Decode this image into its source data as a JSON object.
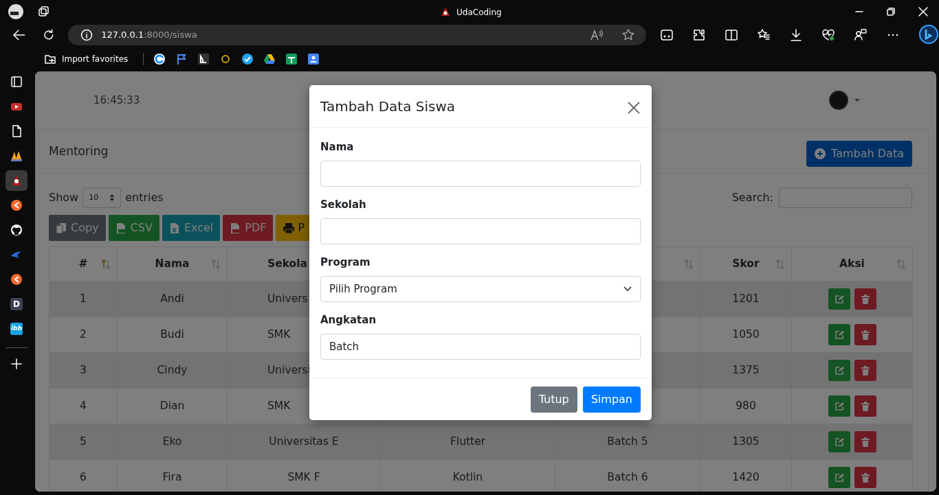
{
  "browser": {
    "title": "UdaCoding",
    "address_host": "127.0.0.1",
    "address_path": ":8000/siswa",
    "favorites_label": "Import favorites"
  },
  "sidebar": [
    {
      "kind": "tabs",
      "selected": false
    },
    {
      "kind": "video",
      "selected": false
    },
    {
      "kind": "document",
      "selected": false
    },
    {
      "kind": "sails",
      "selected": false
    },
    {
      "kind": "rocket",
      "selected": true
    },
    {
      "kind": "orange",
      "selected": false
    },
    {
      "kind": "github",
      "selected": false
    },
    {
      "kind": "bird",
      "selected": false
    },
    {
      "kind": "orange",
      "selected": false
    },
    {
      "kind": "letter",
      "text": "D",
      "selected": false
    },
    {
      "kind": "letter",
      "text": "ibb",
      "selected": false
    },
    {
      "kind": "add",
      "selected": false
    }
  ],
  "page": {
    "clock": "16:45:33",
    "card_title": "Mentoring",
    "add_button": "Tambah Data",
    "show_label": "Show",
    "entries_value": "10",
    "entries_label": "entries",
    "search_label": "Search:",
    "export_buttons": [
      {
        "kind": "copy",
        "label": "Copy"
      },
      {
        "kind": "csv",
        "label": "CSV"
      },
      {
        "kind": "excel",
        "label": "Excel"
      },
      {
        "kind": "pdf",
        "label": "PDF"
      },
      {
        "kind": "print",
        "label": "P"
      }
    ]
  },
  "table": {
    "columns": [
      {
        "label": "#",
        "sorted": true
      },
      {
        "label": "Nama",
        "sorted": false
      },
      {
        "label": "Sekola"
      },
      {},
      {
        "sorted": false
      },
      {
        "label": "Skor",
        "sorted": false
      },
      {
        "label": "Aksi",
        "sorted": false
      }
    ],
    "rows": [
      {
        "number": "1",
        "nama": "Andi",
        "sekolah": "Univers",
        "skor": "1201"
      },
      {
        "number": "2",
        "nama": "Budi",
        "sekolah": "SMK",
        "skor": "1050"
      },
      {
        "number": "3",
        "nama": "Cindy",
        "sekolah": "Universi",
        "skor": "1375"
      },
      {
        "number": "4",
        "nama": "Dian",
        "sekolah": "SMK",
        "skor": "980"
      },
      {
        "number": "5",
        "nama": "Eko",
        "sekolah": "Universitas E",
        "program": "Flutter",
        "angkatan": "Batch 5",
        "skor": "1305"
      },
      {
        "number": "6",
        "nama": "Fira",
        "sekolah": "SMK F",
        "program": "Kotlin",
        "angkatan": "Batch 6",
        "skor": "1420"
      }
    ]
  },
  "modal": {
    "title": "Tambah Data Siswa",
    "fields": [
      {
        "kind": "text",
        "label": "Nama"
      },
      {
        "kind": "text",
        "label": "Sekolah"
      },
      {
        "kind": "select",
        "label": "Program",
        "value": "Pilih Program"
      },
      {
        "kind": "text",
        "label": "Angkatan",
        "value": "Batch"
      }
    ],
    "buttons": [
      {
        "kind": "secondary",
        "label": "Tutup"
      },
      {
        "kind": "primary",
        "label": "Simpan"
      }
    ]
  }
}
